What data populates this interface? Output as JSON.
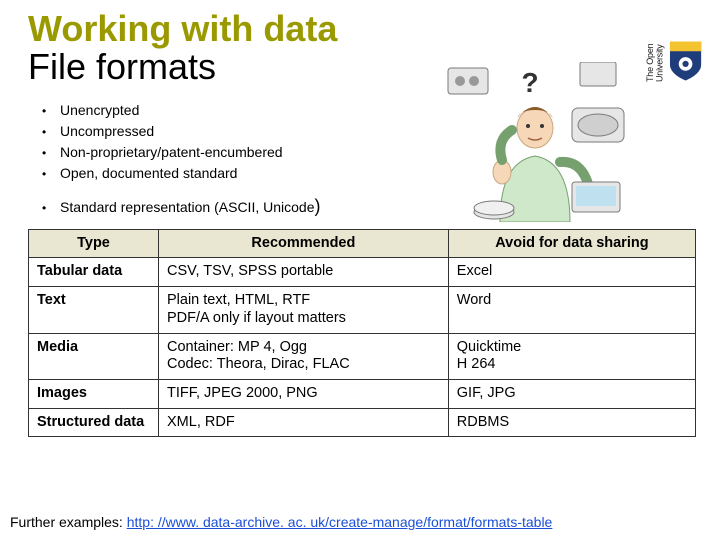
{
  "brand": {
    "name": "The Open University"
  },
  "title": {
    "line1": "Working with data",
    "line2": "File formats"
  },
  "bullets": [
    "Unencrypted",
    "Uncompressed",
    "Non-proprietary/patent-encumbered",
    "Open, documented standard"
  ],
  "bullet_tail": {
    "prefix": "Standard representation (ASCII, Unicode",
    "paren": ")"
  },
  "table": {
    "headers": {
      "c1": "Type",
      "c2": "Recommended",
      "c3": "Avoid for data sharing"
    },
    "rows": [
      {
        "type": "Tabular data",
        "rec": "CSV, TSV, SPSS portable",
        "avoid": "Excel"
      },
      {
        "type": "Text",
        "rec": "Plain text, HTML, RTF\nPDF/A only if layout matters",
        "avoid": "Word"
      },
      {
        "type": "Media",
        "rec": "Container: MP 4, Ogg\nCodec: Theora, Dirac, FLAC",
        "avoid": "Quicktime\nH 264"
      },
      {
        "type": "Images",
        "rec": "TIFF, JPEG 2000, PNG",
        "avoid": "GIF, JPG"
      },
      {
        "type": "Structured data",
        "rec": "XML, RDF",
        "avoid": "RDBMS"
      }
    ]
  },
  "footer": {
    "label": "Further examples: ",
    "url_text": "http: //www. data-archive. ac. uk/create-manage/format/formats-table"
  },
  "icons": {
    "question": "?"
  }
}
